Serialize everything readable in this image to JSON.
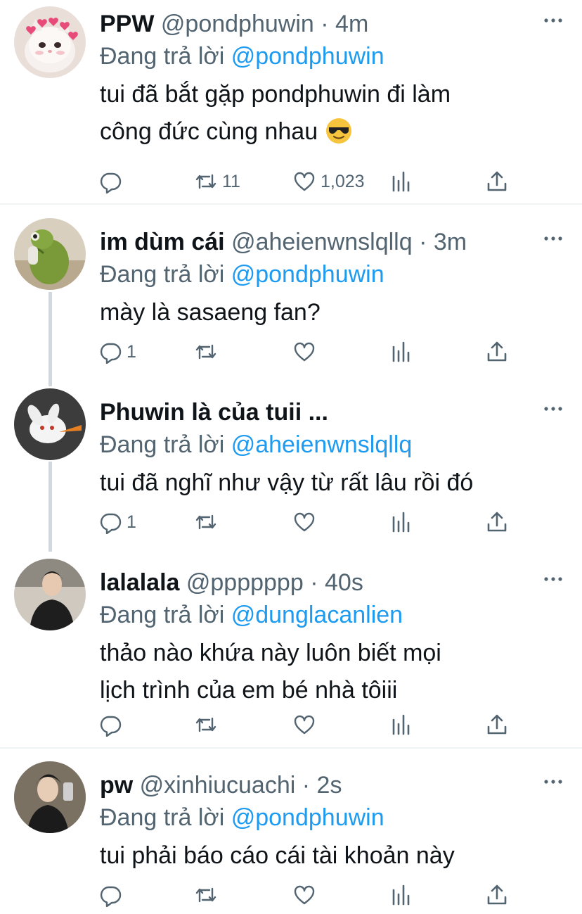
{
  "reply_prefix": "Đang trả lời",
  "more_icon": "more-dots-icon",
  "tweets": [
    {
      "name": "PPW",
      "handle": "@pondphuwin",
      "sep": "·",
      "time": "4m",
      "reply_to": "@pondphuwin",
      "text_lines": [
        "tui đã bắt gặp pondphuwin đi làm",
        "công đức cùng nhau"
      ],
      "emoji": "sunglasses-face-emoji",
      "counts": {
        "reply": "",
        "retweet": "11",
        "like": "1,023"
      },
      "avatar": "white-cat-with-hearts-avatar"
    },
    {
      "name": "im dùm cái",
      "handle": "@aheienwnslqllq",
      "sep": "·",
      "time": "3m",
      "reply_to": "@pondphuwin",
      "text_lines": [
        "mày là sasaeng fan?"
      ],
      "counts": {
        "reply": "1",
        "retweet": "",
        "like": ""
      },
      "avatar": "green-frog-plush-avatar"
    },
    {
      "name": "Phuwin là của tuii ...",
      "handle": "",
      "sep": "",
      "time": "",
      "reply_to": "@aheienwnslqllq",
      "text_lines": [
        "tui đã nghĩ như vậy từ rất lâu rồi đó"
      ],
      "counts": {
        "reply": "1",
        "retweet": "",
        "like": ""
      },
      "avatar": "white-rabbit-with-carrot-avatar"
    },
    {
      "name": "lalalala",
      "handle": "@ppppppp",
      "sep": "·",
      "time": "40s",
      "reply_to": "@dunglacanlien",
      "text_lines": [
        "thảo nào khứa này luôn biết mọi",
        "lịch trình của em bé nhà tôiii"
      ],
      "counts": {
        "reply": "",
        "retweet": "",
        "like": ""
      },
      "avatar": "person-in-black-coat-avatar"
    },
    {
      "name": "pw",
      "handle": "@xinhiucuachi",
      "sep": "·",
      "time": "2s",
      "reply_to": "@pondphuwin",
      "text_lines": [
        "tui phải báo cáo cái tài khoản này"
      ],
      "counts": {
        "reply": "",
        "retweet": "",
        "like": ""
      },
      "avatar": "person-mirror-selfie-avatar"
    }
  ],
  "action_icons": [
    "reply-icon",
    "retweet-icon",
    "like-heart-icon",
    "views-chart-icon",
    "share-icon"
  ]
}
